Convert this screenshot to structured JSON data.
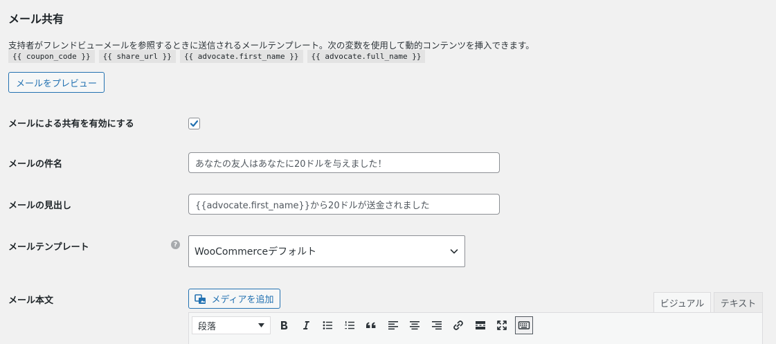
{
  "section": {
    "title": "メール共有",
    "description": "支持者がフレンドビューメールを参照するときに送信されるメールテンプレート。次の変数を使用して動的コンテンツを挿入できます。",
    "variables": [
      "{{ coupon_code }}",
      "{{ share_url }}",
      "{{ advocate.first_name }}",
      "{{ advocate.full_name }}"
    ],
    "preview_button": "メールをプレビュー"
  },
  "fields": {
    "enable_label": "メールによる共有を有効にする",
    "enable_checked": true,
    "subject_label": "メールの件名",
    "subject_placeholder": "あなたの友人はあなたに20ドルを与えました！",
    "heading_label": "メールの見出し",
    "heading_placeholder": "{{advocate.first_name}}から20ドルが送金されました",
    "template_label": "メールテンプレート",
    "template_value": "WooCommerceデフォルト",
    "body_label": "メール本文"
  },
  "editor": {
    "media_button": "メディアを追加",
    "tab_visual": "ビジュアル",
    "tab_text": "テキスト",
    "format_value": "段落"
  },
  "icons": {
    "help": "?"
  }
}
